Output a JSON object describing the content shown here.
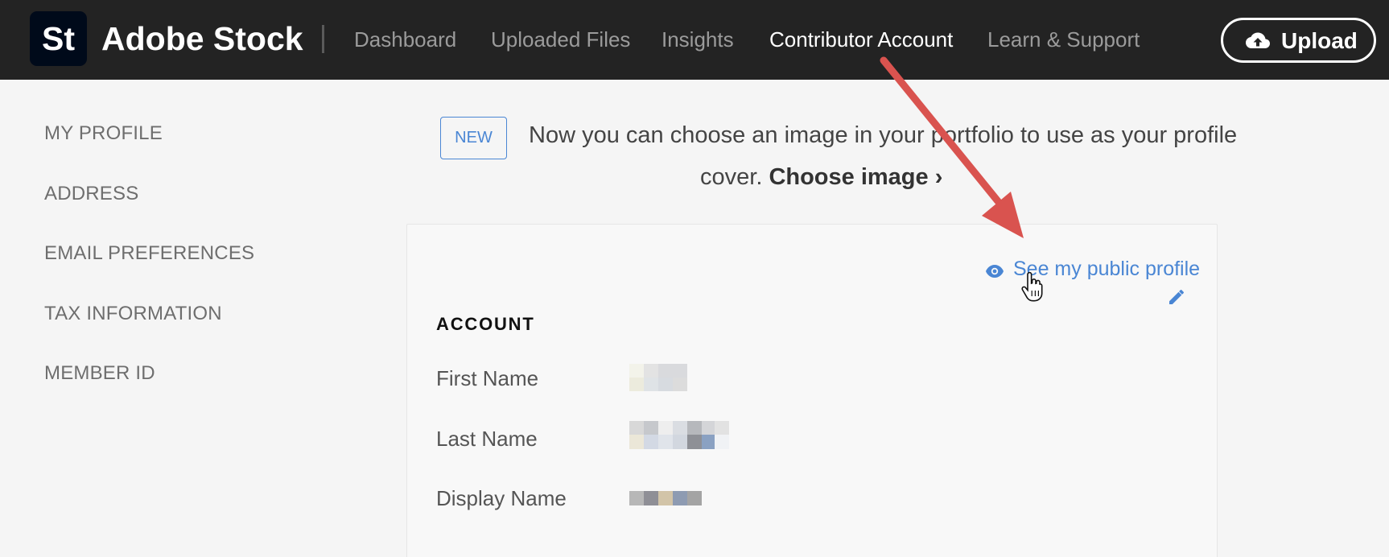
{
  "header": {
    "logo_text": "St",
    "brand": "Adobe Stock",
    "nav": [
      {
        "label": "Dashboard"
      },
      {
        "label": "Uploaded Files"
      },
      {
        "label": "Insights"
      },
      {
        "label": "Contributor Account"
      },
      {
        "label": "Learn & Support"
      }
    ],
    "active_nav": "Contributor Account",
    "upload_label": "Upload",
    "upload_icon": "cloud-upload-icon"
  },
  "sidebar": {
    "items": [
      {
        "label": "MY PROFILE"
      },
      {
        "label": "ADDRESS"
      },
      {
        "label": "EMAIL PREFERENCES"
      },
      {
        "label": "TAX INFORMATION"
      },
      {
        "label": "MEMBER ID"
      }
    ]
  },
  "banner": {
    "badge": "NEW",
    "text_line1": "Now you can choose an image in your portfolio to use as your profile",
    "text_line2_prefix": "cover.",
    "link_label": "Choose image",
    "link_chevron": "›"
  },
  "card": {
    "public_profile_link": "See my public profile",
    "public_profile_icon": "eye-icon",
    "edit_icon": "pencil-icon",
    "section_title": "ACCOUNT",
    "fields": [
      {
        "label": "First Name"
      },
      {
        "label": "Last Name"
      },
      {
        "label": "Display Name"
      }
    ]
  },
  "colors": {
    "header_bg": "#232323",
    "accent_blue": "#4a86d4",
    "annotation_arrow": "#d9534f",
    "page_bg": "#f5f5f5"
  }
}
